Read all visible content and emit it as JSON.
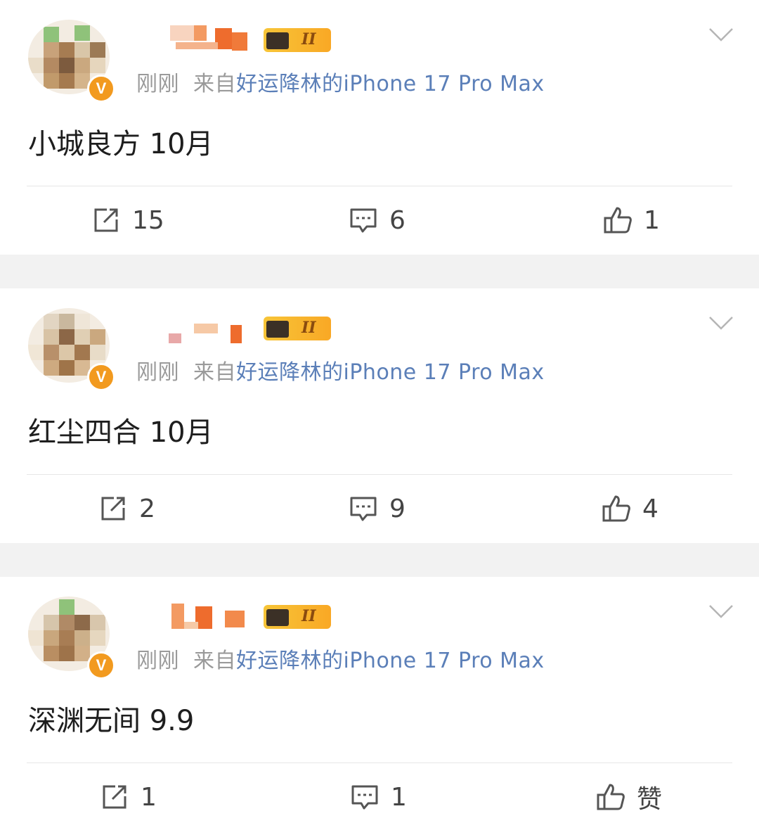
{
  "posts": [
    {
      "time": "刚刚",
      "from_prefix": "来自",
      "source": "好运降林的iPhone 17 Pro Max",
      "content": "小城良方 10月",
      "level": "II",
      "verified": "V",
      "repost_count": "15",
      "comment_count": "6",
      "like_count": "1"
    },
    {
      "time": "刚刚",
      "from_prefix": "来自",
      "source": "好运降林的iPhone 17 Pro Max",
      "content": "红尘四合 10月",
      "level": "II",
      "verified": "V",
      "repost_count": "2",
      "comment_count": "9",
      "like_count": "4"
    },
    {
      "time": "刚刚",
      "from_prefix": "来自",
      "source": "好运降林的iPhone 17 Pro Max",
      "content": "深渊无间 9.9",
      "level": "II",
      "verified": "V",
      "repost_count": "1",
      "comment_count": "1",
      "like_count": "赞"
    }
  ],
  "colors": {
    "source_link": "#5b7fb8",
    "meta_gray": "#9a9a9a",
    "badge_orange": "#f29a1f",
    "level_gold": "#f7c538"
  },
  "icons": {
    "repost": "repost-icon",
    "comment": "comment-icon",
    "like": "thumbs-up-icon",
    "menu": "chevron-down-icon"
  }
}
